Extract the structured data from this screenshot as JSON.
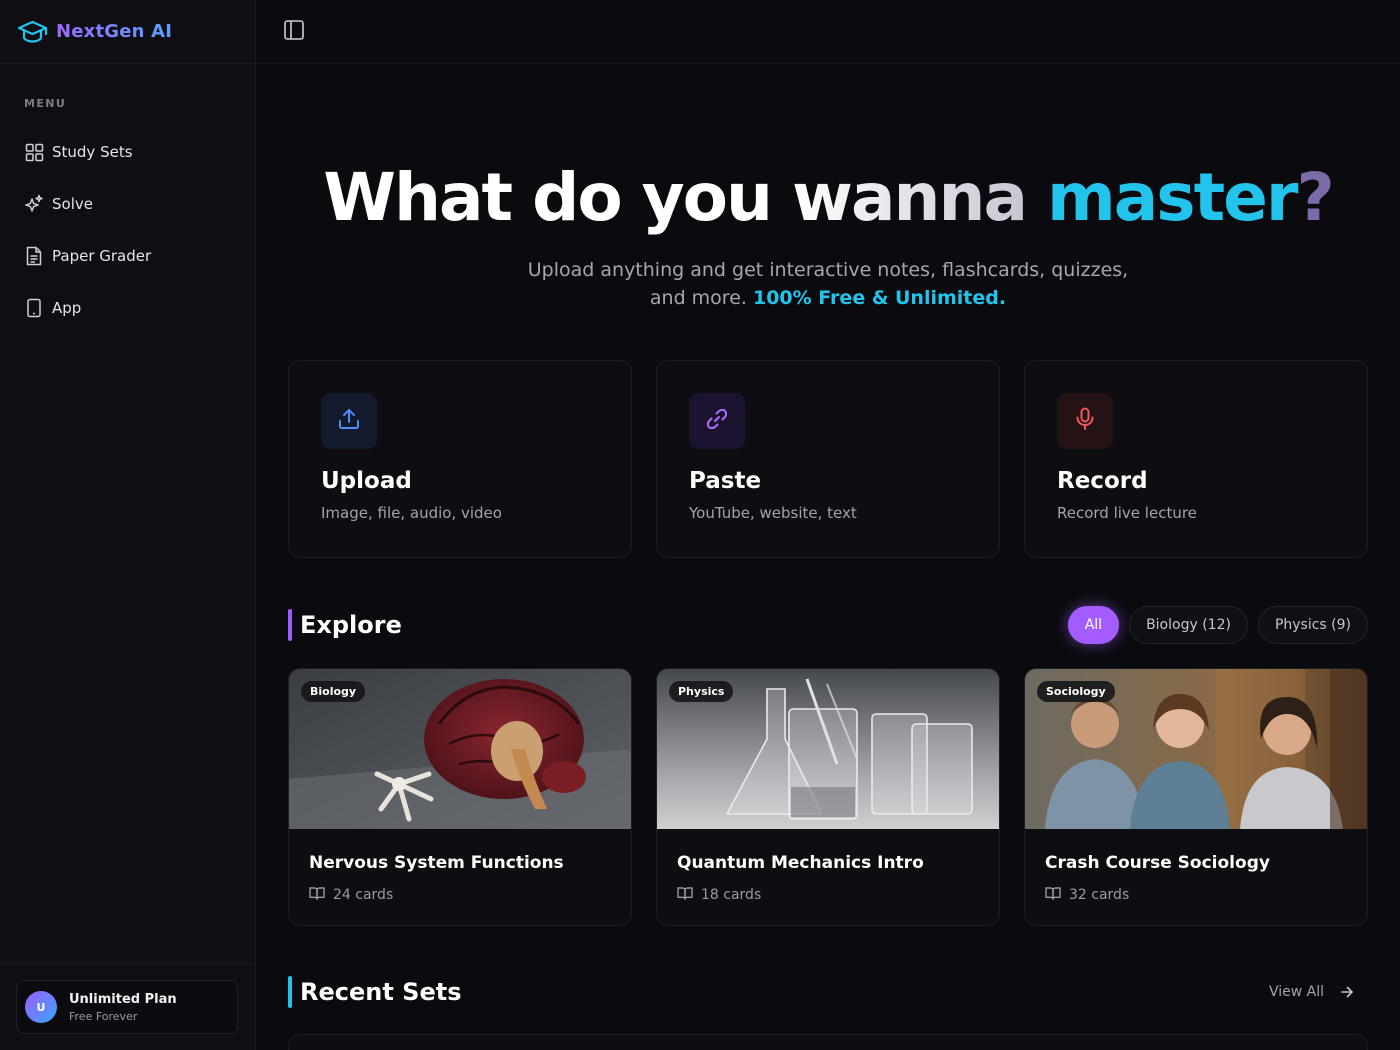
{
  "brand": {
    "name": "NextGen AI",
    "icon": "graduation-cap-icon",
    "color": "#22c4ec"
  },
  "sidebar": {
    "menu_label": "MENU",
    "items": [
      {
        "label": "Study Sets",
        "icon": "grid-icon"
      },
      {
        "label": "Solve",
        "icon": "sparkles-icon"
      },
      {
        "label": "Paper Grader",
        "icon": "document-icon"
      },
      {
        "label": "App",
        "icon": "smartphone-icon"
      }
    ],
    "plan": {
      "avatar": "U",
      "title": "Unlimited Plan",
      "subtitle": "Free Forever"
    }
  },
  "topbar": {
    "toggle_icon": "sidebar-toggle-icon"
  },
  "hero": {
    "title_part1": "What do you",
    "title_part2": "wanna",
    "title_part3": "master",
    "title_part4": "?",
    "subtitle": "Upload anything and get interactive notes, flashcards, quizzes, and more.",
    "highlight": "100% Free & Unlimited.",
    "highlight_color": "#22c4ec"
  },
  "actions": [
    {
      "title": "Upload",
      "description": "Image, file, audio, video",
      "icon": "upload-icon",
      "color": "#3b82f6"
    },
    {
      "title": "Paste",
      "description": "YouTube, website, text",
      "icon": "link-icon",
      "color": "#a855f7"
    },
    {
      "title": "Record",
      "description": "Record live lecture",
      "icon": "microphone-icon",
      "color": "#ef4444"
    }
  ],
  "explore": {
    "title": "Explore",
    "accent": "#a25cff",
    "filters": [
      {
        "label": "All",
        "active": true
      },
      {
        "label": "Biology (12)",
        "active": false
      },
      {
        "label": "Physics (9)",
        "active": false
      }
    ],
    "sets": [
      {
        "tag": "Biology",
        "title": "Nervous System Functions",
        "cards": "24 cards"
      },
      {
        "tag": "Physics",
        "title": "Quantum Mechanics Intro",
        "cards": "18 cards"
      },
      {
        "tag": "Sociology",
        "title": "Crash Course Sociology",
        "cards": "32 cards"
      }
    ]
  },
  "recent": {
    "title": "Recent Sets",
    "accent": "#22c4ec",
    "view_all": "View All"
  }
}
